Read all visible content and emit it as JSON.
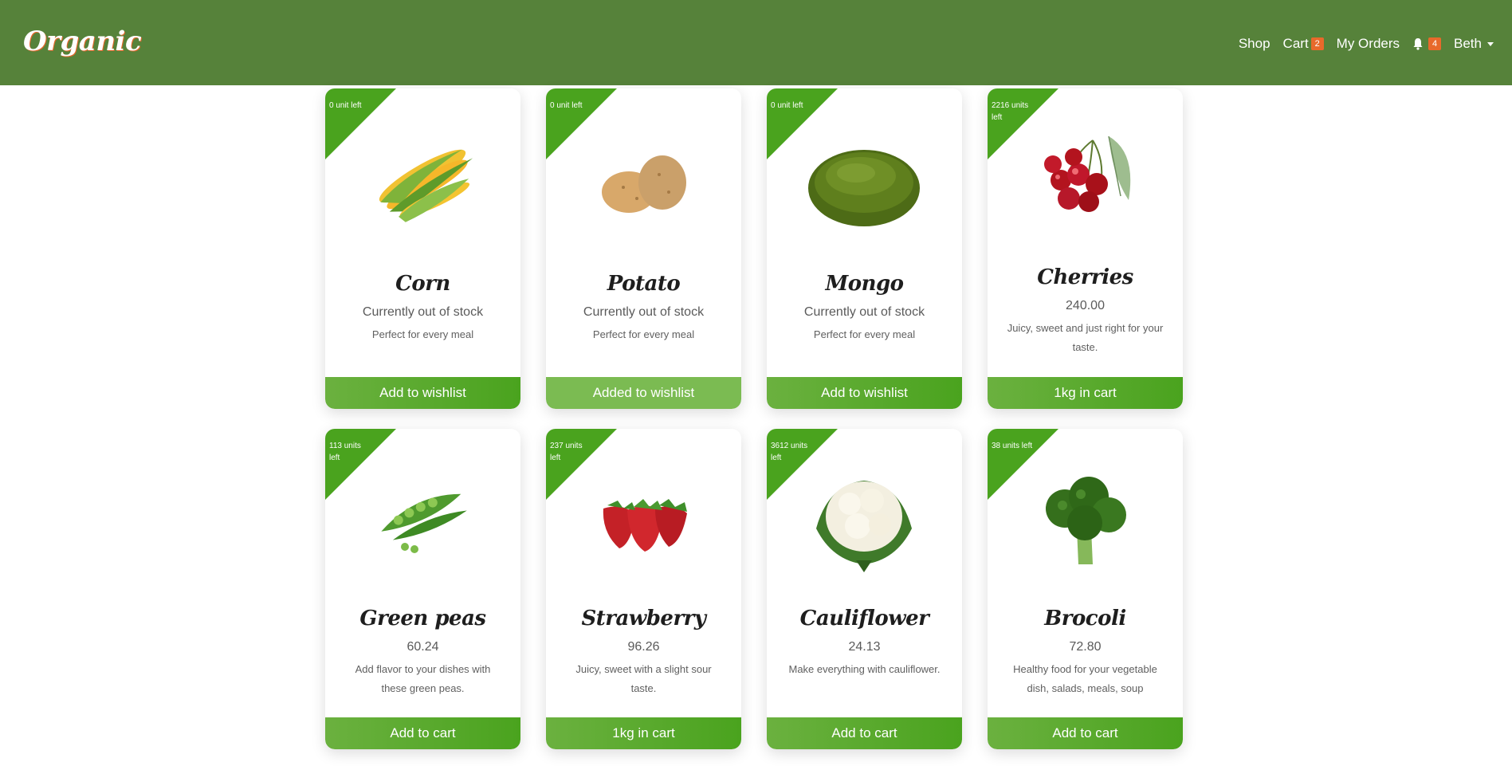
{
  "navbar": {
    "brand": "Organic",
    "shop_label": "Shop",
    "cart_label": "Cart",
    "cart_count": "2",
    "orders_label": "My Orders",
    "notifications_count": "4",
    "user_name": "Beth"
  },
  "colors": {
    "navbar": "#56823a",
    "accent_green": "#4aa31e",
    "badge": "#e8692b"
  },
  "products": [
    {
      "stock": "0 unit left",
      "name": "Corn",
      "price": "Currently out of stock",
      "description": "Perfect for every meal",
      "button": "Add to wishlist",
      "icon": "corn-image"
    },
    {
      "stock": "0 unit left",
      "name": "Potato",
      "price": "Currently out of stock",
      "description": "Perfect for every meal",
      "button": "Added to wishlist",
      "icon": "potato-image"
    },
    {
      "stock": "0 unit left",
      "name": "Mongo",
      "price": "Currently out of stock",
      "description": "Perfect for every meal",
      "button": "Add to wishlist",
      "icon": "mongo-image"
    },
    {
      "stock": "2216 units left",
      "name": "Cherries",
      "price": "240.00",
      "description": "Juicy, sweet and just right for your taste.",
      "button": "1kg in cart",
      "icon": "cherries-image"
    },
    {
      "stock": "113 units left",
      "name": "Green peas",
      "price": "60.24",
      "description": "Add flavor to your dishes with these green peas.",
      "button": "Add to cart",
      "icon": "green-peas-image"
    },
    {
      "stock": "237 units left",
      "name": "Strawberry",
      "price": "96.26",
      "description": "Juicy, sweet with a slight sour taste.",
      "button": "1kg in cart",
      "icon": "strawberry-image"
    },
    {
      "stock": "3612 units left",
      "name": "Cauliflower",
      "price": "24.13",
      "description": "Make everything with cauliflower.",
      "button": "Add to cart",
      "icon": "cauliflower-image"
    },
    {
      "stock": "38 units left",
      "name": "Brocoli",
      "price": "72.80",
      "description": "Healthy food for your vegetable dish, salads, meals, soup",
      "button": "Add to cart",
      "icon": "broccoli-image"
    }
  ]
}
